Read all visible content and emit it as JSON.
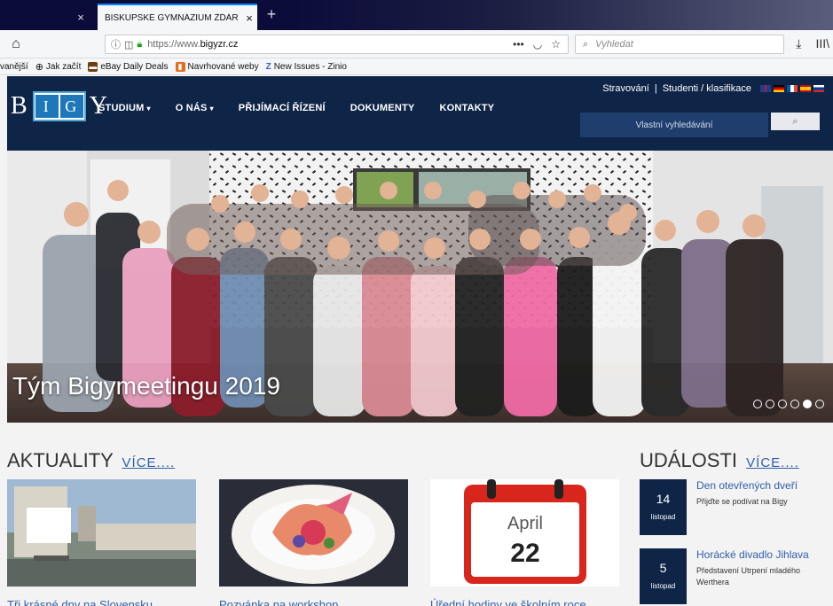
{
  "browser": {
    "inactive_tab_close": "×",
    "active_tab": {
      "title": "BISKUPSKÉ GYMNÁZIUM ŽĎÁR NA",
      "close": "×"
    },
    "new_tab": "+",
    "url": {
      "prefix": "https://www.",
      "domain": "bigyzr.cz"
    },
    "url_actions": [
      "•••",
      "◡",
      "☆"
    ],
    "search_placeholder": "Vyhledat",
    "nav_right": [
      "⤓",
      "III\\"
    ],
    "bookmarks": [
      {
        "label": "vanější",
        "icon": "",
        "color": ""
      },
      {
        "label": "Jak začít",
        "icon": "globe-icon",
        "color": "#333333"
      },
      {
        "label": "eBay Daily Deals",
        "icon": "bag-icon",
        "color": "#6b3f10"
      },
      {
        "label": "Navrhované weby",
        "icon": "bookmark-icon",
        "color": "#e66a1a"
      },
      {
        "label": "New Issues - Zinio",
        "icon": "z-icon",
        "color": "#2b66c8"
      }
    ]
  },
  "site": {
    "logo": {
      "left": "B",
      "book": [
        "I",
        "G"
      ],
      "right": "Y"
    },
    "nav": [
      {
        "label": "STUDIUM",
        "caret": "▾"
      },
      {
        "label": "O NÁS",
        "caret": "▾"
      },
      {
        "label": "PŘIJÍMACÍ ŘÍZENÍ",
        "caret": ""
      },
      {
        "label": "DOKUMENTY",
        "caret": ""
      },
      {
        "label": "KONTAKTY",
        "caret": ""
      }
    ],
    "top_links": {
      "food": "Stravování",
      "sep": "|",
      "students": "Studenti / klasifikace"
    },
    "flags": [
      {
        "name": "uk-flag",
        "colors": [
          "#1f3f8c",
          "#c8102e",
          "#ffffff"
        ]
      },
      {
        "name": "de-flag",
        "colors": [
          "#000000",
          "#dd0000",
          "#ffce00"
        ]
      },
      {
        "name": "fr-flag",
        "colors": [
          "#0055a4",
          "#ffffff",
          "#ef4135"
        ]
      },
      {
        "name": "es-flag",
        "colors": [
          "#c60b1e",
          "#ffc400",
          "#c60b1e"
        ]
      },
      {
        "name": "ru-flag",
        "colors": [
          "#ffffff",
          "#0039a6",
          "#d52b1e"
        ]
      }
    ],
    "search_placeholder": "Vlastní vyhledávání",
    "search_button": "🔍"
  },
  "hero": {
    "caption": "Tým Bigymeetingu 2019",
    "slides": 6,
    "active_slide": 4
  },
  "news": {
    "heading": "AKTUALITY",
    "more": "VÍCE....",
    "items": [
      {
        "title": "Tři krásné dny na Slovensku"
      },
      {
        "title": "Pozvánka na workshop"
      },
      {
        "title": "Úřední hodiny ve školním roce"
      }
    ],
    "calendar": {
      "month": "April",
      "day": "22"
    }
  },
  "events": {
    "heading": "UDÁLOSTI",
    "more": "VÍCE....",
    "items": [
      {
        "day": "14",
        "month": "listopad",
        "title": "Den otevřených dveří",
        "desc": "Přijďte se podívat na Bigy"
      },
      {
        "day": "5",
        "month": "listopad",
        "title": "Horácké divadlo Jihlava",
        "desc": "Představení Utrpení mladého Werthera"
      }
    ]
  },
  "colors": {
    "header": "#0f2548",
    "link": "#2f5fa8",
    "accent": "#1e77b8"
  }
}
